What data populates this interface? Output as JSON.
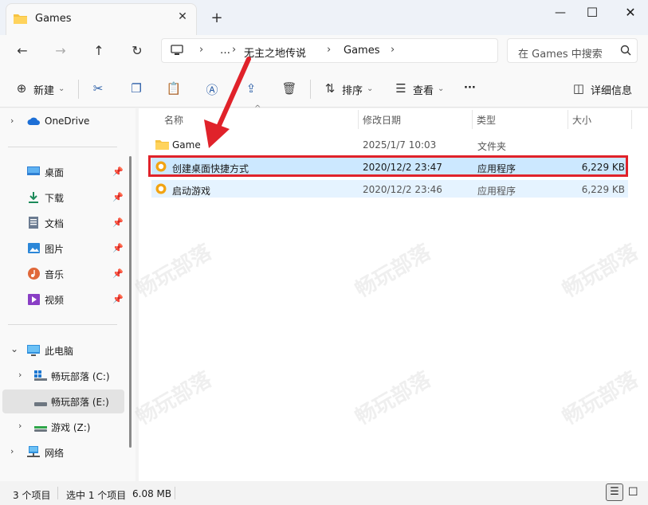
{
  "window": {
    "tab_title": "Games",
    "tab_close": "✕",
    "tab_add": "+",
    "minimize": "—",
    "maximize": "☐",
    "close": "✕"
  },
  "nav": {
    "back": "←",
    "forward": "→",
    "up": "↑",
    "refresh": "↻",
    "breadcrumb": [
      "…",
      "无主之地传说",
      "Games"
    ],
    "search_placeholder": "在 Games 中搜索"
  },
  "toolbar": {
    "new_label": "新建",
    "sort_label": "排序",
    "view_label": "查看",
    "more_label": "···",
    "details_label": "详细信息"
  },
  "sidebar": {
    "onedrive": "OneDrive",
    "quick": [
      {
        "label": "桌面",
        "icon": "desktop-icon"
      },
      {
        "label": "下载",
        "icon": "download-icon"
      },
      {
        "label": "文档",
        "icon": "document-icon"
      },
      {
        "label": "图片",
        "icon": "picture-icon"
      },
      {
        "label": "音乐",
        "icon": "music-icon"
      },
      {
        "label": "视频",
        "icon": "video-icon"
      }
    ],
    "this_pc": "此电脑",
    "drives": [
      {
        "label": "畅玩部落 (C:)"
      },
      {
        "label": "畅玩部落 (E:)"
      },
      {
        "label": "游戏 (Z:)"
      }
    ],
    "network": "网络"
  },
  "columns": {
    "name": "名称",
    "modified": "修改日期",
    "type": "类型",
    "size": "大小"
  },
  "files": [
    {
      "name": "Game",
      "modified": "2025/1/7 10:03",
      "type": "文件夹",
      "size": ""
    },
    {
      "name": "创建桌面快捷方式",
      "modified": "2020/12/2 23:47",
      "type": "应用程序",
      "size": "6,229 KB"
    },
    {
      "name": "启动游戏",
      "modified": "2020/12/2 23:46",
      "type": "应用程序",
      "size": "6,229 KB"
    }
  ],
  "status": {
    "item_count": "3 个项目",
    "selection": "选中 1 个项目",
    "selection_size": "6.08 MB"
  },
  "colors": {
    "accent": "#0067c0",
    "selected_row": "#cce8ff",
    "highlight_box": "#e0222a",
    "arrow": "#e0222a"
  }
}
